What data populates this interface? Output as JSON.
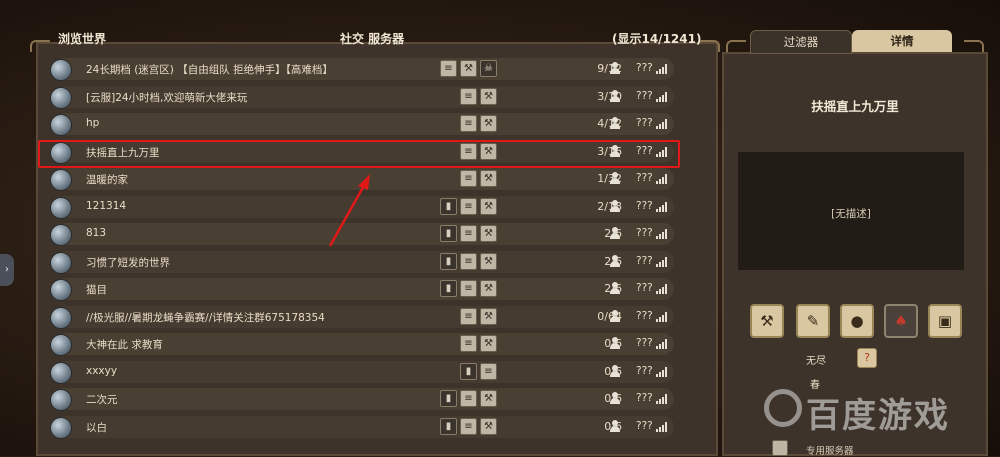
{
  "header": {
    "browse_title": "浏览世界",
    "category": "社交 服务器",
    "showing": "(显示14/1241)"
  },
  "servers": [
    {
      "name": "24长期档 (迷宫区) 【自由组队 拒绝伸手】【高难档】",
      "count": "9/12",
      "ping": "???",
      "icons": [
        "scroll-icon",
        "wrench-icon",
        "skull-icon"
      ]
    },
    {
      "name": "[云服]24小时档,欢迎萌新大佬来玩",
      "count": "3/10",
      "ping": "???",
      "icons": [
        "scroll-icon",
        "wrench-icon"
      ]
    },
    {
      "name": "hp",
      "count": "4/12",
      "ping": "???",
      "icons": [
        "scroll-icon",
        "wrench-icon"
      ]
    },
    {
      "name": "扶摇直上九万里",
      "count": "3/16",
      "ping": "???",
      "icons": [
        "scroll-icon",
        "wrench-icon"
      ]
    },
    {
      "name": "温暖的家",
      "count": "1/32",
      "ping": "???",
      "icons": [
        "scroll-icon",
        "wrench-icon"
      ]
    },
    {
      "name": "121314",
      "count": "2/18",
      "ping": "???",
      "icons": [
        "door-icon",
        "scroll-icon",
        "wrench-icon"
      ]
    },
    {
      "name": "813",
      "count": "2/6",
      "ping": "???",
      "icons": [
        "door-icon",
        "scroll-icon",
        "wrench-icon"
      ]
    },
    {
      "name": "习惯了短发的世界",
      "count": "2/6",
      "ping": "???",
      "icons": [
        "door-icon",
        "scroll-icon",
        "wrench-icon"
      ]
    },
    {
      "name": "猫目",
      "count": "2/6",
      "ping": "???",
      "icons": [
        "door-icon",
        "scroll-icon",
        "wrench-icon"
      ]
    },
    {
      "name": "//极光服//暑期龙蝇争霸赛//详情关注群675178354",
      "count": "0/64",
      "ping": "???",
      "icons": [
        "scroll-icon",
        "wrench-icon"
      ]
    },
    {
      "name": "大神在此 求教育",
      "count": "0/6",
      "ping": "???",
      "icons": [
        "scroll-icon",
        "wrench-icon"
      ]
    },
    {
      "name": "xxxyy",
      "count": "0/6",
      "ping": "???",
      "icons": [
        "door-icon",
        "scroll-icon"
      ]
    },
    {
      "name": "二次元",
      "count": "0/6",
      "ping": "???",
      "icons": [
        "door-icon",
        "scroll-icon",
        "wrench-icon"
      ]
    },
    {
      "name": "以白",
      "count": "0/6",
      "ping": "???",
      "icons": [
        "door-icon",
        "scroll-icon",
        "wrench-icon"
      ]
    }
  ],
  "right_panel": {
    "tab_filter": "过滤器",
    "tab_details": "详情",
    "selected_server": "扶摇直上九万里",
    "description": "[无描述]",
    "mode_label": "无尽",
    "season": "春",
    "server_type": "专用服务器"
  },
  "watermark": "百度游戏",
  "colors": {
    "highlight": "#e01818",
    "tab_active": "#d8c7a0",
    "panel": "#3d332a"
  }
}
